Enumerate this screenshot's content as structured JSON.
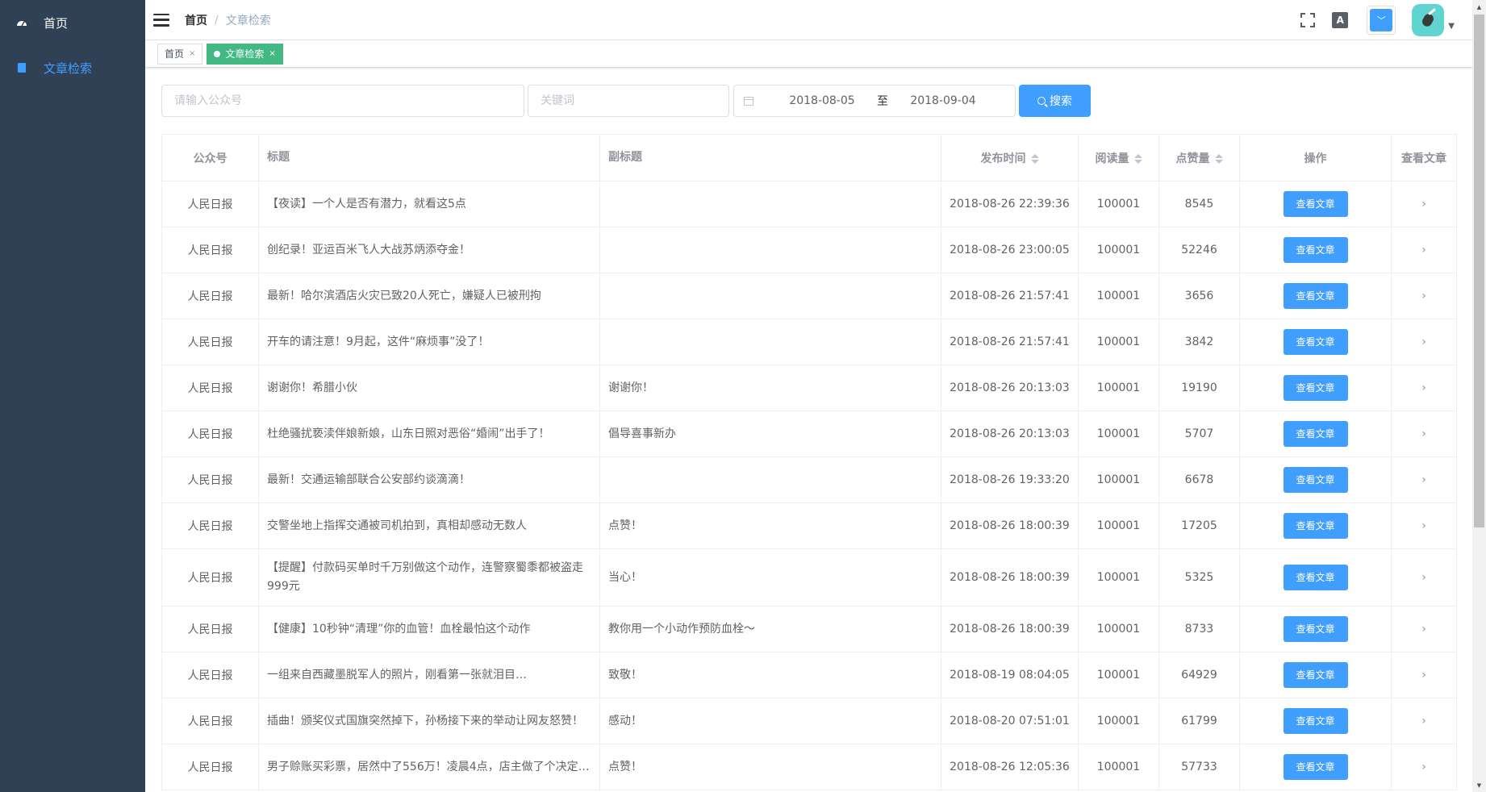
{
  "sidebar": {
    "items": [
      {
        "label": "首页",
        "icon": "dashboard-icon"
      },
      {
        "label": "文章检索",
        "icon": "document-icon"
      }
    ]
  },
  "navbar": {
    "breadcrumb_home": "首页",
    "breadcrumb_sep": "/",
    "breadcrumb_current": "文章检索",
    "size_icon_text": "A",
    "theme_icon_text": "﹀",
    "avatar_caret": "▼"
  },
  "tags": [
    {
      "label": "首页",
      "close": "×"
    },
    {
      "label": "文章检索",
      "close": "×"
    }
  ],
  "search": {
    "account_placeholder": "请输入公众号",
    "keyword_placeholder": "关键词",
    "date_start": "2018-08-05",
    "date_sep": "至",
    "date_end": "2018-09-04",
    "button_label": "搜索"
  },
  "table": {
    "headers": [
      "公众号",
      "标题",
      "副标题",
      "发布时间",
      "阅读量",
      "点赞量",
      "操作",
      "查看文章"
    ],
    "action_label": "查看文章",
    "chevron": "›",
    "rows": [
      {
        "account": "人民日报",
        "title": "【夜读】一个人是否有潜力，就看这5点",
        "subtitle": "",
        "time": "2018-08-26 22:39:36",
        "reads": "100001",
        "likes": "8545"
      },
      {
        "account": "人民日报",
        "title": "创纪录！亚运百米飞人大战苏炳添夺金！",
        "subtitle": "",
        "time": "2018-08-26 23:00:05",
        "reads": "100001",
        "likes": "52246"
      },
      {
        "account": "人民日报",
        "title": "最新！哈尔滨酒店火灾已致20人死亡，嫌疑人已被刑拘",
        "subtitle": "",
        "time": "2018-08-26 21:57:41",
        "reads": "100001",
        "likes": "3656"
      },
      {
        "account": "人民日报",
        "title": "开车的请注意！9月起，这件“麻烦事”没了！",
        "subtitle": "",
        "time": "2018-08-26 21:57:41",
        "reads": "100001",
        "likes": "3842"
      },
      {
        "account": "人民日报",
        "title": "谢谢你！希腊小伙",
        "subtitle": "谢谢你！",
        "time": "2018-08-26 20:13:03",
        "reads": "100001",
        "likes": "19190"
      },
      {
        "account": "人民日报",
        "title": "杜绝骚扰亵渎伴娘新娘，山东日照对恶俗“婚闹”出手了！",
        "subtitle": "倡导喜事新办",
        "time": "2018-08-26 20:13:03",
        "reads": "100001",
        "likes": "5707"
      },
      {
        "account": "人民日报",
        "title": "最新！交通运输部联合公安部约谈滴滴！",
        "subtitle": "",
        "time": "2018-08-26 19:33:20",
        "reads": "100001",
        "likes": "6678"
      },
      {
        "account": "人民日报",
        "title": "交警坐地上指挥交通被司机拍到，真相却感动无数人",
        "subtitle": "点赞！",
        "time": "2018-08-26 18:00:39",
        "reads": "100001",
        "likes": "17205"
      },
      {
        "account": "人民日报",
        "title": "【提醒】付款码买单时千万别做这个动作，连警察蜀黍都被盗走999元",
        "subtitle": "当心！",
        "time": "2018-08-26 18:00:39",
        "reads": "100001",
        "likes": "5325"
      },
      {
        "account": "人民日报",
        "title": "【健康】10秒钟“清理”你的血管！血栓最怕这个动作",
        "subtitle": "教你用一个小动作预防血栓～",
        "time": "2018-08-26 18:00:39",
        "reads": "100001",
        "likes": "8733"
      },
      {
        "account": "人民日报",
        "title": "一组来自西藏墨脱军人的照片，刚看第一张就泪目…",
        "subtitle": "致敬！",
        "time": "2018-08-19 08:04:05",
        "reads": "100001",
        "likes": "64929"
      },
      {
        "account": "人民日报",
        "title": "插曲！颁奖仪式国旗突然掉下，孙杨接下来的举动让网友怒赞！",
        "subtitle": "感动！",
        "time": "2018-08-20 07:51:01",
        "reads": "100001",
        "likes": "61799"
      },
      {
        "account": "人民日报",
        "title": "男子赊账买彩票，居然中了556万！凌晨4点，店主做了个决定…",
        "subtitle": "点赞！",
        "time": "2018-08-26 12:05:36",
        "reads": "100001",
        "likes": "57733"
      }
    ]
  },
  "colors": {
    "sidebar_bg": "#304156",
    "primary": "#409EFF",
    "active_tag": "#42b983"
  }
}
